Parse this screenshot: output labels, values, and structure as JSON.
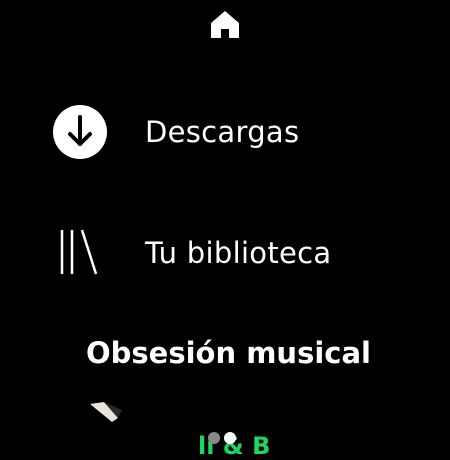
{
  "nav": {
    "home_icon": "home-icon"
  },
  "menu": {
    "downloads": {
      "label": "Descargas",
      "icon": "download-circle-icon"
    },
    "library": {
      "label": "Tu biblioteca",
      "icon": "library-icon"
    }
  },
  "section": {
    "title": "Obsesión musical"
  },
  "peek": {
    "text": "li & B"
  },
  "pager": {
    "count": 2,
    "active_index": 1
  },
  "colors": {
    "background": "#000000",
    "text": "#ffffff",
    "accent_green": "#1ed760",
    "dot_inactive": "#8a8a8a",
    "dot_active": "#ffffff"
  }
}
